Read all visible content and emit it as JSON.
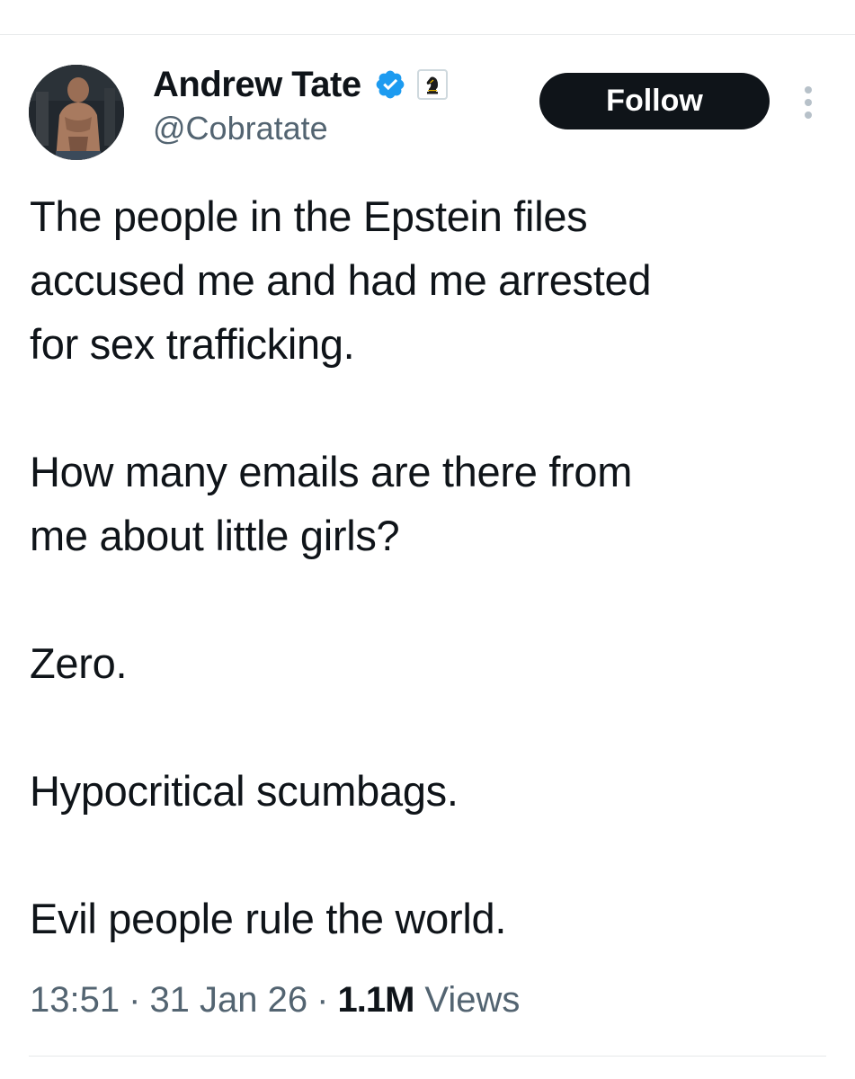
{
  "author": {
    "display_name": "Andrew Tate",
    "handle": "@Cobratate",
    "avatar_icon": "profile-photo",
    "verified_icon": "verified-badge-icon",
    "affiliate_icon": "chess-knight-badge-icon"
  },
  "actions": {
    "follow_label": "Follow",
    "more_icon": "more-vertical-icon"
  },
  "tweet": {
    "paragraphs": [
      [
        "The people in the Epstein files",
        "accused me and had me arrested",
        "for sex trafficking."
      ],
      [
        "How many emails are there from",
        "me about little girls?"
      ],
      [
        "Zero."
      ],
      [
        "Hypocritical scumbags."
      ],
      [
        "Evil people rule the world."
      ]
    ]
  },
  "meta": {
    "time": "13:51",
    "separator": "·",
    "date": "31 Jan 26",
    "views_count": "1.1M",
    "views_label": "Views"
  },
  "colors": {
    "text_primary": "#0f1419",
    "text_secondary": "#536471",
    "verified_blue": "#1d9bf0",
    "follow_bg": "#0f1419",
    "divider": "#e7e9ea"
  }
}
